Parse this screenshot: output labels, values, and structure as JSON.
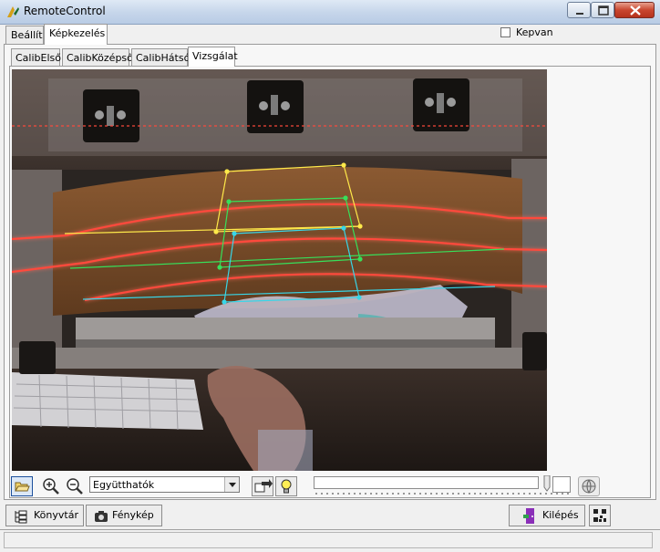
{
  "window": {
    "title": "RemoteControl"
  },
  "main_tabs": [
    {
      "label": "Beállít",
      "selected": false
    },
    {
      "label": "Képkezelés",
      "selected": true
    }
  ],
  "kepvan_checkbox": {
    "label": "Kepvan",
    "checked": false
  },
  "sub_tabs": [
    {
      "label": "CalibElső",
      "selected": false
    },
    {
      "label": "CalibKözépső",
      "selected": false
    },
    {
      "label": "CalibHátsó",
      "selected": false
    },
    {
      "label": "Vizsgálat",
      "selected": true
    }
  ],
  "toolbar": {
    "open_icon": "open-folder-icon",
    "zoom_in_icon": "zoom-in-icon",
    "zoom_out_icon": "zoom-out-icon",
    "combo_value": "Együtthatók",
    "export_icon": "export-icon",
    "bulb_icon": "lightbulb-icon",
    "progress_fraction": 0.0,
    "globe_icon": "globe-icon"
  },
  "bottom_buttons": {
    "library_label": "Könyvtár",
    "photo_label": "Fénykép",
    "exit_label": "Kilépés"
  },
  "colors": {
    "overlay_yellow": "#ffe94a",
    "overlay_green": "#37e05a",
    "overlay_cyan": "#38d6e8",
    "laser_red": "#ff3b30",
    "selection_blue": "#1c4f9c"
  }
}
